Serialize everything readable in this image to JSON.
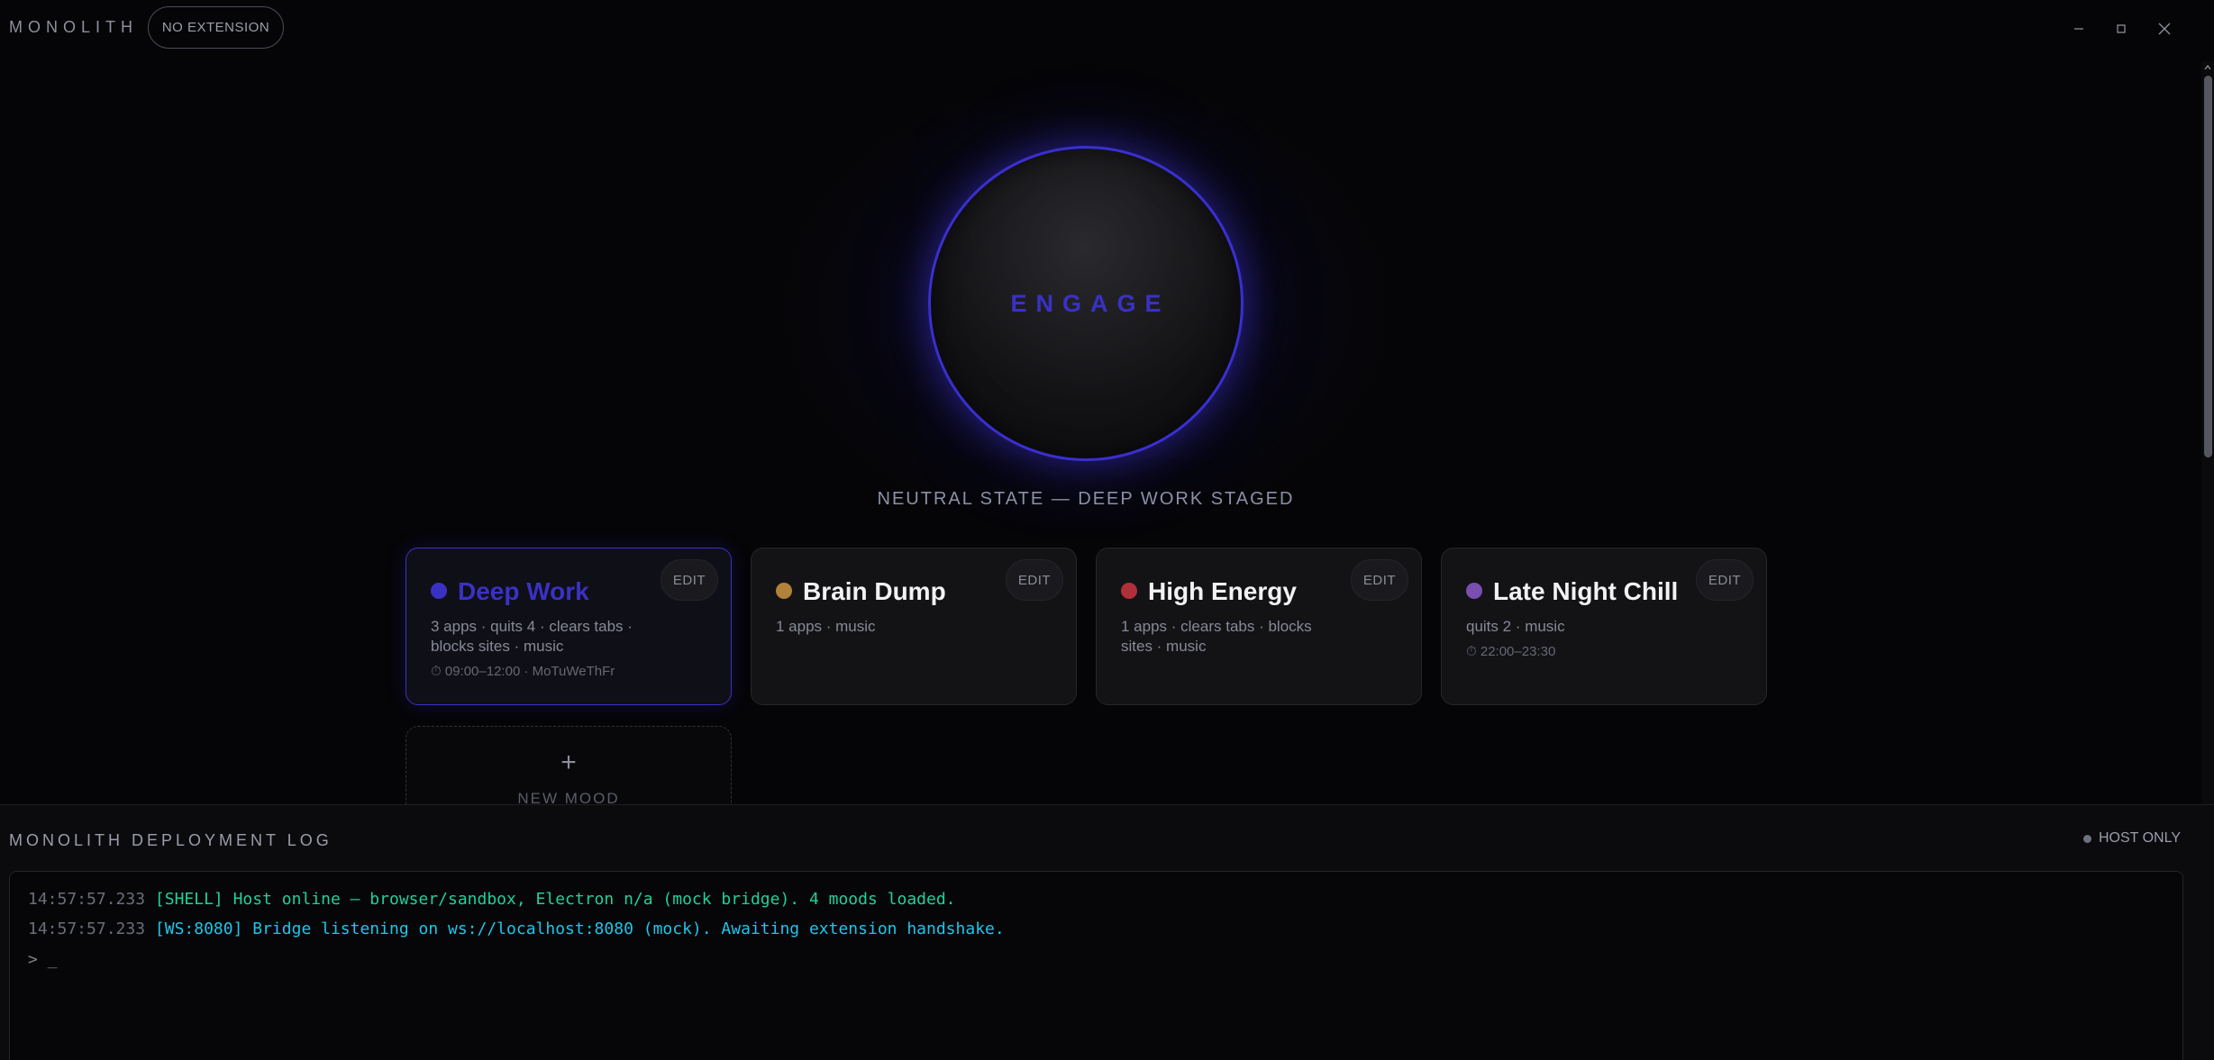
{
  "titlebar": {
    "brand": "MONOLITH",
    "extension_badge": "NO EXTENSION"
  },
  "engage": {
    "label": "ENGAGE",
    "accent_color": "#3a31c4"
  },
  "state_text": "NEUTRAL STATE — DEEP WORK STAGED",
  "moods": [
    {
      "name": "Deep Work",
      "dot_color": "#3a31c4",
      "edit_label": "EDIT",
      "meta": "3 apps · quits 4 · clears tabs · blocks sites · music",
      "schedule": "⏱ 09:00–12:00 · MoTuWeThFr",
      "active": true
    },
    {
      "name": "Brain Dump",
      "dot_color": "#b0823a",
      "edit_label": "EDIT",
      "meta": "1 apps · music",
      "schedule": "",
      "active": false
    },
    {
      "name": "High Energy",
      "dot_color": "#b0303a",
      "edit_label": "EDIT",
      "meta": "1 apps · clears tabs · blocks sites · music",
      "schedule": "",
      "active": false
    },
    {
      "name": "Late Night Chill",
      "dot_color": "#7a4fb0",
      "edit_label": "EDIT",
      "meta": "quits 2 · music",
      "schedule": "⏱ 22:00–23:30",
      "active": false
    }
  ],
  "new_mood": {
    "icon": "+",
    "label": "NEW MOOD"
  },
  "log": {
    "title": "MONOLITH DEPLOYMENT LOG",
    "host_status": "HOST ONLY",
    "lines": [
      {
        "time": "14:57:57.233",
        "message": "[SHELL] Host online — browser/sandbox, Electron n/a (mock bridge). 4 moods loaded.",
        "color": "#1fd19a"
      },
      {
        "time": "14:57:57.233",
        "message": "[WS:8080] Bridge listening on ws://localhost:8080 (mock). Awaiting extension handshake.",
        "color": "#1ec5ea"
      }
    ],
    "prompt": "> _"
  }
}
